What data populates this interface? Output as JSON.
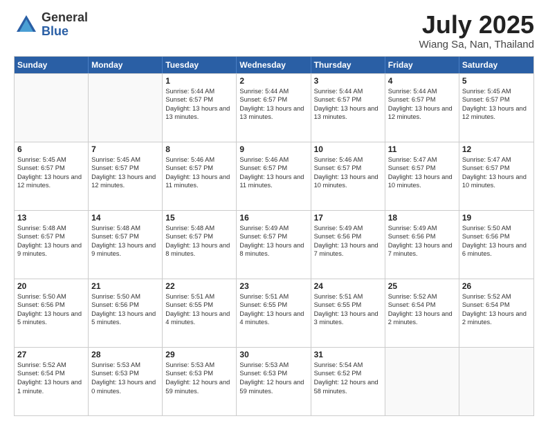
{
  "logo": {
    "general": "General",
    "blue": "Blue"
  },
  "title": "July 2025",
  "location": "Wiang Sa, Nan, Thailand",
  "days_of_week": [
    "Sunday",
    "Monday",
    "Tuesday",
    "Wednesday",
    "Thursday",
    "Friday",
    "Saturday"
  ],
  "weeks": [
    [
      {
        "day": "",
        "empty": true
      },
      {
        "day": "",
        "empty": true
      },
      {
        "day": "1",
        "sunrise": "Sunrise: 5:44 AM",
        "sunset": "Sunset: 6:57 PM",
        "daylight": "Daylight: 13 hours and 13 minutes."
      },
      {
        "day": "2",
        "sunrise": "Sunrise: 5:44 AM",
        "sunset": "Sunset: 6:57 PM",
        "daylight": "Daylight: 13 hours and 13 minutes."
      },
      {
        "day": "3",
        "sunrise": "Sunrise: 5:44 AM",
        "sunset": "Sunset: 6:57 PM",
        "daylight": "Daylight: 13 hours and 13 minutes."
      },
      {
        "day": "4",
        "sunrise": "Sunrise: 5:44 AM",
        "sunset": "Sunset: 6:57 PM",
        "daylight": "Daylight: 13 hours and 12 minutes."
      },
      {
        "day": "5",
        "sunrise": "Sunrise: 5:45 AM",
        "sunset": "Sunset: 6:57 PM",
        "daylight": "Daylight: 13 hours and 12 minutes."
      }
    ],
    [
      {
        "day": "6",
        "sunrise": "Sunrise: 5:45 AM",
        "sunset": "Sunset: 6:57 PM",
        "daylight": "Daylight: 13 hours and 12 minutes."
      },
      {
        "day": "7",
        "sunrise": "Sunrise: 5:45 AM",
        "sunset": "Sunset: 6:57 PM",
        "daylight": "Daylight: 13 hours and 12 minutes."
      },
      {
        "day": "8",
        "sunrise": "Sunrise: 5:46 AM",
        "sunset": "Sunset: 6:57 PM",
        "daylight": "Daylight: 13 hours and 11 minutes."
      },
      {
        "day": "9",
        "sunrise": "Sunrise: 5:46 AM",
        "sunset": "Sunset: 6:57 PM",
        "daylight": "Daylight: 13 hours and 11 minutes."
      },
      {
        "day": "10",
        "sunrise": "Sunrise: 5:46 AM",
        "sunset": "Sunset: 6:57 PM",
        "daylight": "Daylight: 13 hours and 10 minutes."
      },
      {
        "day": "11",
        "sunrise": "Sunrise: 5:47 AM",
        "sunset": "Sunset: 6:57 PM",
        "daylight": "Daylight: 13 hours and 10 minutes."
      },
      {
        "day": "12",
        "sunrise": "Sunrise: 5:47 AM",
        "sunset": "Sunset: 6:57 PM",
        "daylight": "Daylight: 13 hours and 10 minutes."
      }
    ],
    [
      {
        "day": "13",
        "sunrise": "Sunrise: 5:48 AM",
        "sunset": "Sunset: 6:57 PM",
        "daylight": "Daylight: 13 hours and 9 minutes."
      },
      {
        "day": "14",
        "sunrise": "Sunrise: 5:48 AM",
        "sunset": "Sunset: 6:57 PM",
        "daylight": "Daylight: 13 hours and 9 minutes."
      },
      {
        "day": "15",
        "sunrise": "Sunrise: 5:48 AM",
        "sunset": "Sunset: 6:57 PM",
        "daylight": "Daylight: 13 hours and 8 minutes."
      },
      {
        "day": "16",
        "sunrise": "Sunrise: 5:49 AM",
        "sunset": "Sunset: 6:57 PM",
        "daylight": "Daylight: 13 hours and 8 minutes."
      },
      {
        "day": "17",
        "sunrise": "Sunrise: 5:49 AM",
        "sunset": "Sunset: 6:56 PM",
        "daylight": "Daylight: 13 hours and 7 minutes."
      },
      {
        "day": "18",
        "sunrise": "Sunrise: 5:49 AM",
        "sunset": "Sunset: 6:56 PM",
        "daylight": "Daylight: 13 hours and 7 minutes."
      },
      {
        "day": "19",
        "sunrise": "Sunrise: 5:50 AM",
        "sunset": "Sunset: 6:56 PM",
        "daylight": "Daylight: 13 hours and 6 minutes."
      }
    ],
    [
      {
        "day": "20",
        "sunrise": "Sunrise: 5:50 AM",
        "sunset": "Sunset: 6:56 PM",
        "daylight": "Daylight: 13 hours and 5 minutes."
      },
      {
        "day": "21",
        "sunrise": "Sunrise: 5:50 AM",
        "sunset": "Sunset: 6:56 PM",
        "daylight": "Daylight: 13 hours and 5 minutes."
      },
      {
        "day": "22",
        "sunrise": "Sunrise: 5:51 AM",
        "sunset": "Sunset: 6:55 PM",
        "daylight": "Daylight: 13 hours and 4 minutes."
      },
      {
        "day": "23",
        "sunrise": "Sunrise: 5:51 AM",
        "sunset": "Sunset: 6:55 PM",
        "daylight": "Daylight: 13 hours and 4 minutes."
      },
      {
        "day": "24",
        "sunrise": "Sunrise: 5:51 AM",
        "sunset": "Sunset: 6:55 PM",
        "daylight": "Daylight: 13 hours and 3 minutes."
      },
      {
        "day": "25",
        "sunrise": "Sunrise: 5:52 AM",
        "sunset": "Sunset: 6:54 PM",
        "daylight": "Daylight: 13 hours and 2 minutes."
      },
      {
        "day": "26",
        "sunrise": "Sunrise: 5:52 AM",
        "sunset": "Sunset: 6:54 PM",
        "daylight": "Daylight: 13 hours and 2 minutes."
      }
    ],
    [
      {
        "day": "27",
        "sunrise": "Sunrise: 5:52 AM",
        "sunset": "Sunset: 6:54 PM",
        "daylight": "Daylight: 13 hours and 1 minute."
      },
      {
        "day": "28",
        "sunrise": "Sunrise: 5:53 AM",
        "sunset": "Sunset: 6:53 PM",
        "daylight": "Daylight: 13 hours and 0 minutes."
      },
      {
        "day": "29",
        "sunrise": "Sunrise: 5:53 AM",
        "sunset": "Sunset: 6:53 PM",
        "daylight": "Daylight: 12 hours and 59 minutes."
      },
      {
        "day": "30",
        "sunrise": "Sunrise: 5:53 AM",
        "sunset": "Sunset: 6:53 PM",
        "daylight": "Daylight: 12 hours and 59 minutes."
      },
      {
        "day": "31",
        "sunrise": "Sunrise: 5:54 AM",
        "sunset": "Sunset: 6:52 PM",
        "daylight": "Daylight: 12 hours and 58 minutes."
      },
      {
        "day": "",
        "empty": true
      },
      {
        "day": "",
        "empty": true
      }
    ]
  ]
}
